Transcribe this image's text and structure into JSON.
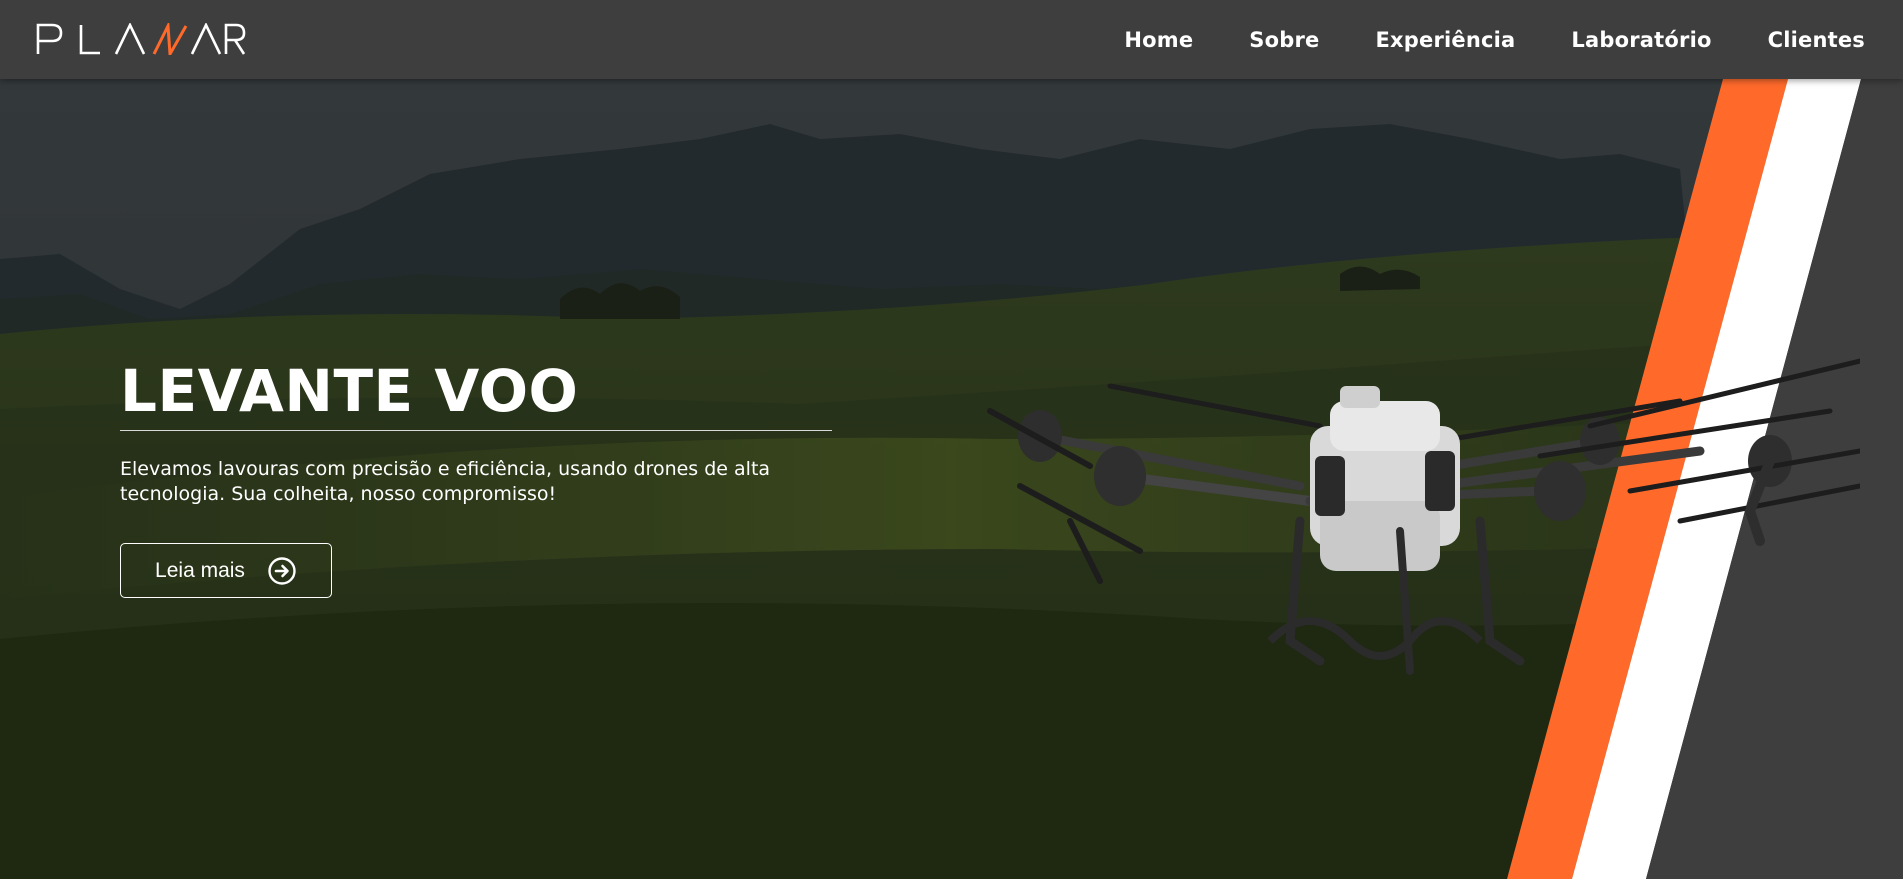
{
  "brand": {
    "name": "PLANAR",
    "accent_color": "#ff6a2b",
    "header_color": "#3e3e3e"
  },
  "nav": {
    "items": [
      {
        "label": "Home"
      },
      {
        "label": "Sobre"
      },
      {
        "label": "Experiência"
      },
      {
        "label": "Laboratório"
      },
      {
        "label": "Clientes"
      }
    ]
  },
  "hero": {
    "title": "LEVANTE VOO",
    "description": "Elevamos lavouras com precisão e eficiência, usando drones de alta tecnologia. Sua colheita, nosso compromisso!",
    "button_label": "Leia mais",
    "button_icon": "arrow-right-circle-icon"
  }
}
